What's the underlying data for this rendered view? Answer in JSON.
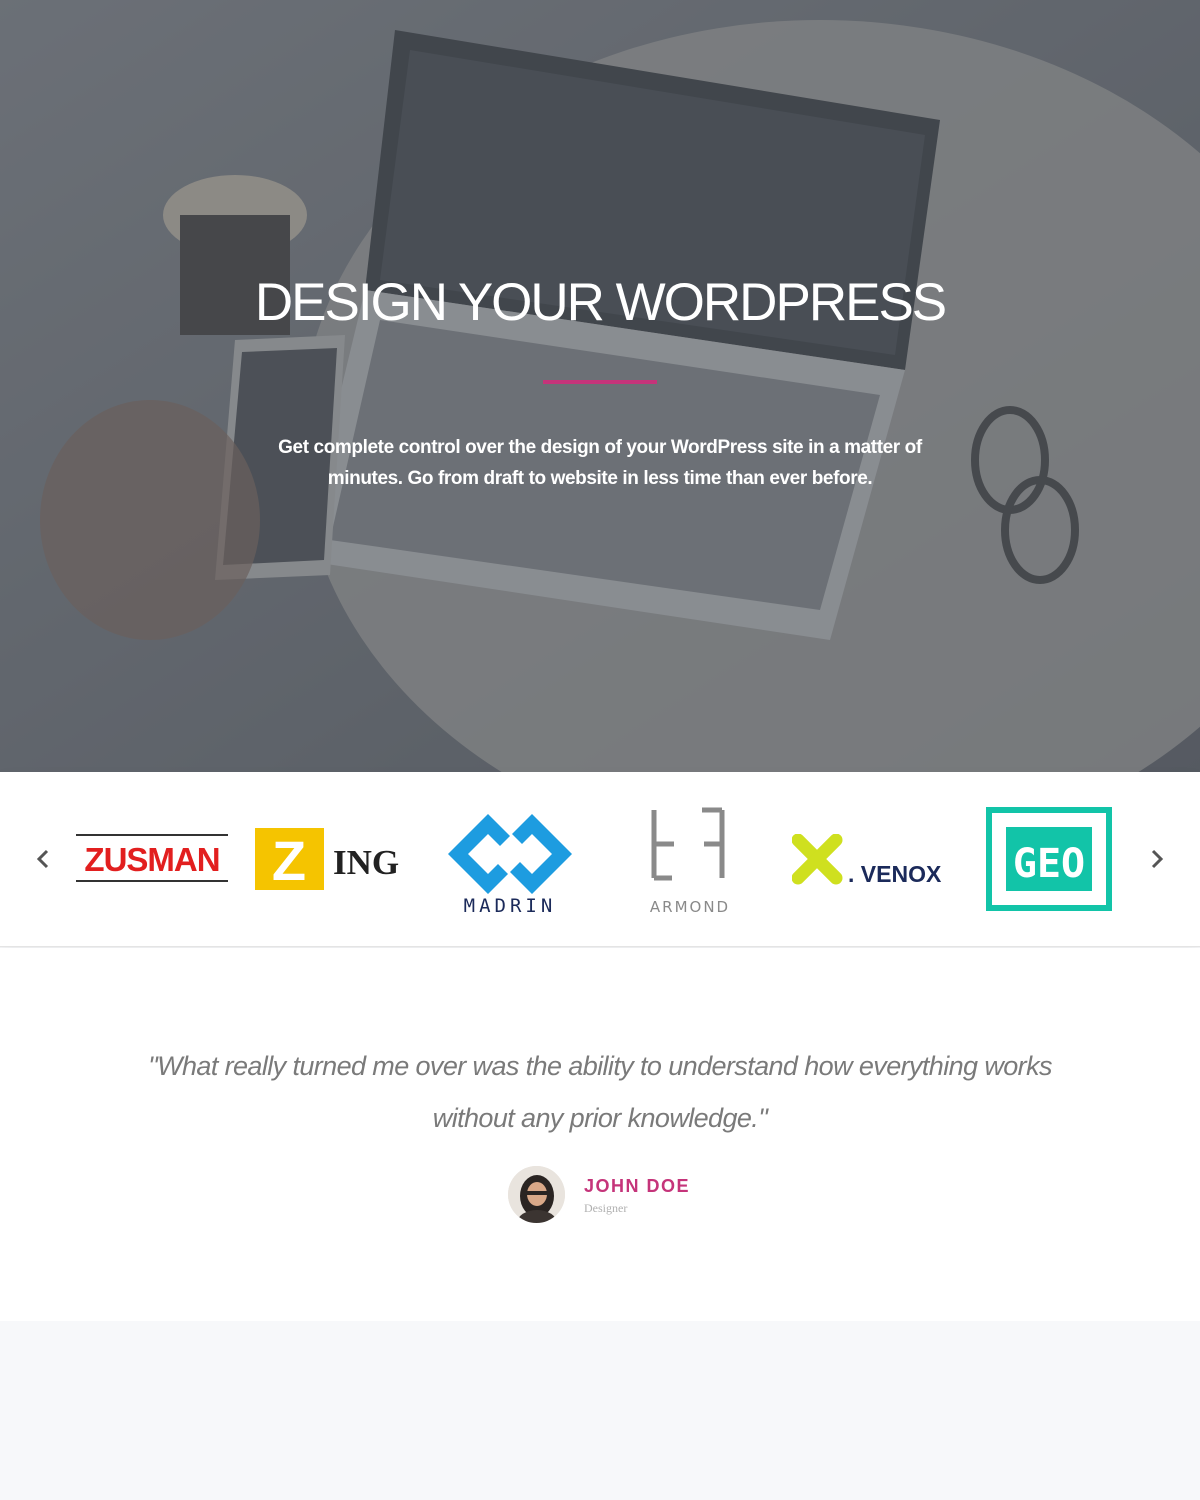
{
  "hero": {
    "title": "DESIGN YOUR WORDPRESS",
    "subtitle": "Get complete control over the design of your WordPress site in a matter of minutes. Go from draft to website in less time than ever before.",
    "accent_color": "#c5347a"
  },
  "logo_carousel": {
    "prev_icon": "chevron-left-icon",
    "next_icon": "chevron-right-icon",
    "logos": [
      {
        "name": "ZUSMAN",
        "color": "#e21f1f"
      },
      {
        "name": "ING",
        "mark": "Z",
        "color": "#f5c400"
      },
      {
        "name": "MADRIN",
        "color": "#1d9ce0"
      },
      {
        "name": "ARMOND",
        "color": "#8a8a8a"
      },
      {
        "name": ". VENOX",
        "color": "#cfe01f"
      },
      {
        "name": "GEO",
        "color": "#12c4a8"
      }
    ]
  },
  "testimonial": {
    "quote": "\"What really turned me over was the ability to understand how everything works without any prior knowledge.\"",
    "author_name": "JOHN DOE",
    "author_role": "Designer",
    "name_color": "#c5347a"
  }
}
